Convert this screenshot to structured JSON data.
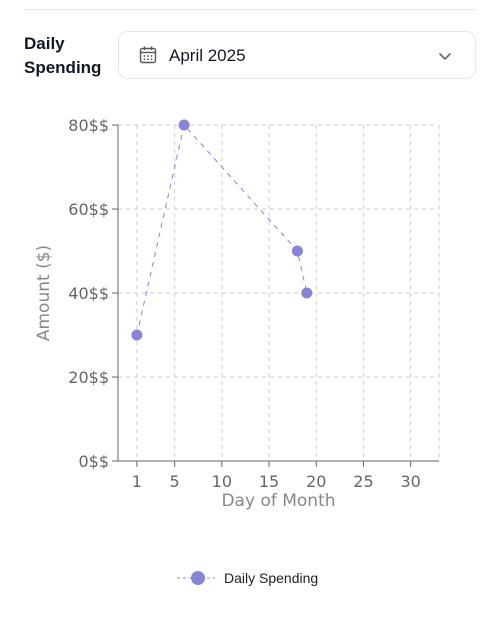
{
  "header": {
    "title": "Daily Spending",
    "month_select": {
      "value": "April 2025",
      "icon": "calendar-icon",
      "dropdown_icon": "chevron-down-icon"
    }
  },
  "chart_data": {
    "type": "line",
    "xlabel": "Day of Month",
    "ylabel": "Amount ($)",
    "xlim": [
      -1,
      33
    ],
    "ylim": [
      0,
      80
    ],
    "x_ticks": [
      1,
      5,
      10,
      15,
      20,
      25,
      30
    ],
    "x_tick_labels": [
      "1",
      "5",
      "10",
      "15",
      "20",
      "25",
      "30"
    ],
    "y_ticks": [
      0,
      20,
      40,
      60,
      80
    ],
    "y_tick_labels": [
      "0$$",
      "20$$",
      "40$$",
      "60$$",
      "80$$"
    ],
    "grid": true,
    "legend_position": "bottom-center",
    "series": [
      {
        "name": "Daily Spending",
        "color": "#8884d8",
        "line_style": "dashed",
        "points": [
          {
            "x": 1,
            "y": 30
          },
          {
            "x": 6,
            "y": 80
          },
          {
            "x": 18,
            "y": 50
          },
          {
            "x": 19,
            "y": 40
          }
        ]
      }
    ]
  }
}
